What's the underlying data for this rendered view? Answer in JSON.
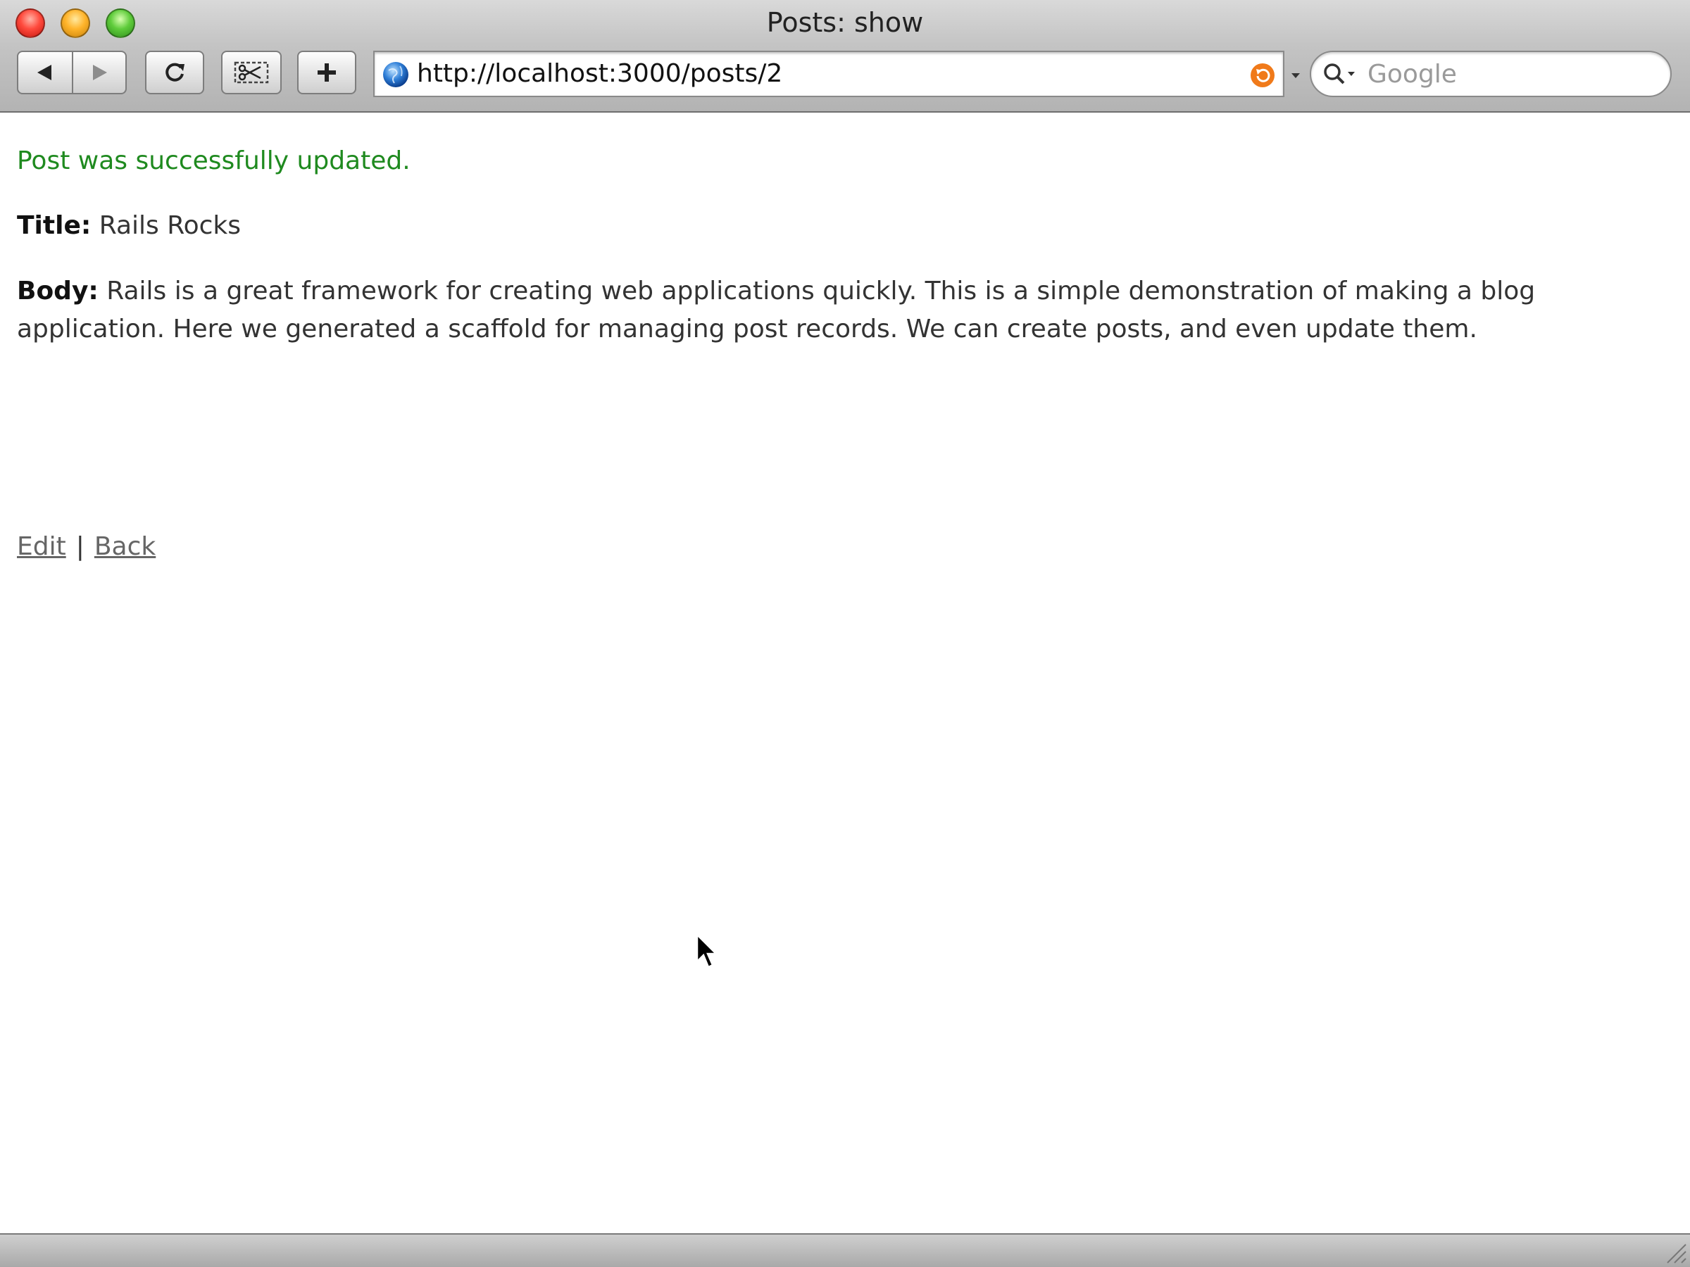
{
  "window": {
    "title": "Posts: show"
  },
  "toolbar": {
    "url": "http://localhost:3000/posts/2",
    "search_placeholder": "Google"
  },
  "page": {
    "notice": "Post was successfully updated.",
    "title_label": "Title:",
    "title_value": "Rails Rocks",
    "body_label": "Body:",
    "body_value": "Rails is a great framework for creating web applications quickly. This is a simple demonstration of making a blog application. Here we generated a scaffold for managing post records. We can create posts, and even update them.",
    "edit_link": "Edit",
    "separator": "|",
    "back_link": "Back"
  },
  "colors": {
    "notice_green": "#1f8a1f",
    "link_gray": "#666666"
  },
  "icons": {
    "close": "close-button-red",
    "minimize": "minimize-button-yellow",
    "zoom": "zoom-button-green",
    "back": "back-arrow-icon",
    "forward": "forward-arrow-icon",
    "reload": "reload-icon",
    "snip": "web-clip-icon",
    "add": "add-bookmark-icon",
    "globe": "globe-icon",
    "snapback": "snapback-icon",
    "search": "search-icon"
  }
}
